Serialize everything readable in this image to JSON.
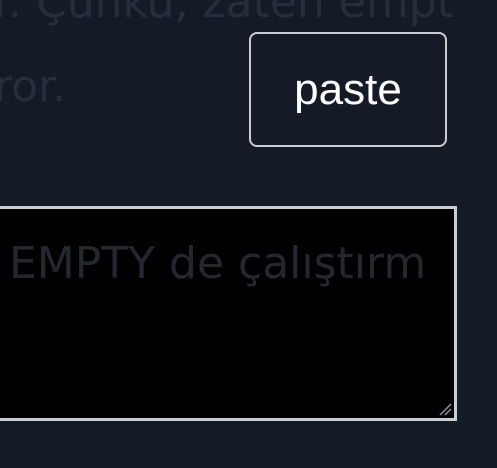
{
  "background": {
    "line_1": "r. Çünkü, zaten empt",
    "line_2": "ror."
  },
  "toolbar": {
    "paste_label": "paste"
  },
  "editor": {
    "placeholder_visible_text": "EMPTY de çalıştırm"
  },
  "colors": {
    "page_background": "#141b27",
    "button_border": "#c9ccd1",
    "text_area_background": "#000000",
    "button_text": "#ffffff"
  },
  "icons": {
    "resize_handle": "resize-grip-icon"
  }
}
